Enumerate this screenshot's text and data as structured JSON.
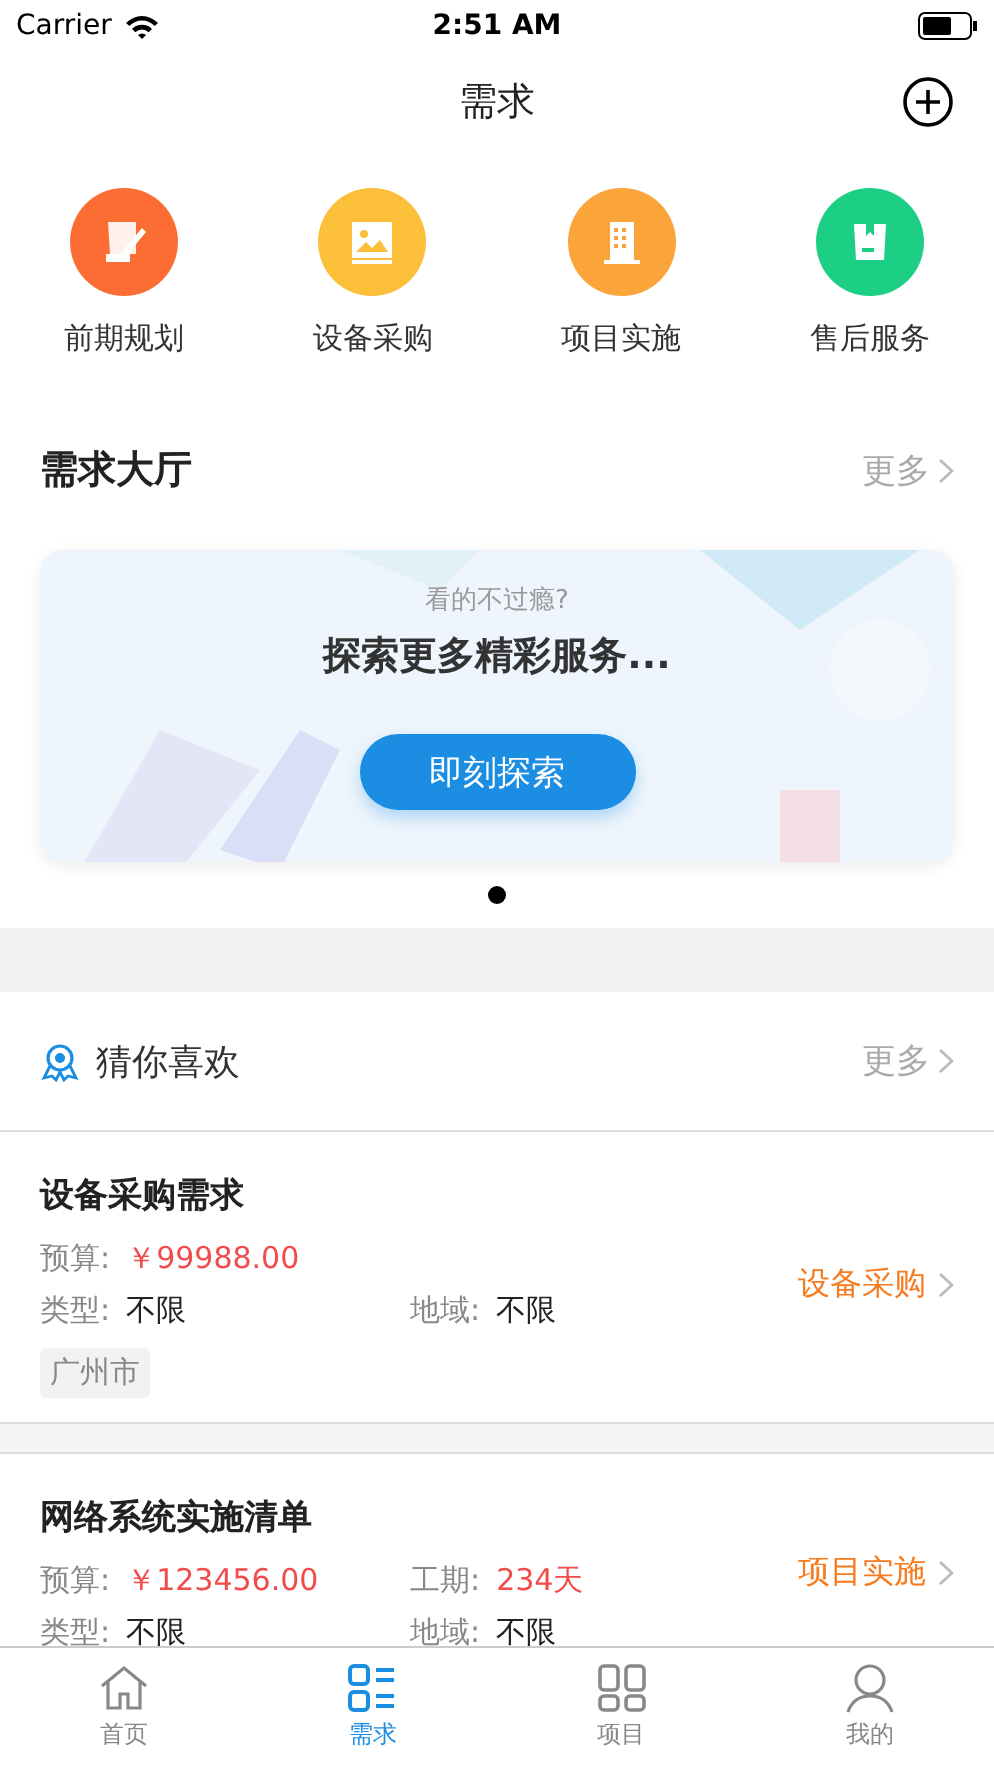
{
  "status_bar": {
    "carrier": "Carrier",
    "time": "2:51 AM"
  },
  "nav": {
    "title": "需求"
  },
  "categories": [
    {
      "label": "前期规划",
      "kind": "plan",
      "color": "#fb6d32"
    },
    {
      "label": "设备采购",
      "color": "#fbbf3a"
    },
    {
      "label": "项目实施",
      "kind": "building",
      "color": "#fba43a"
    },
    {
      "label": "售后服务",
      "kind": "bag",
      "color": "#1ccf85"
    }
  ],
  "hall": {
    "title": "需求大厅",
    "more": "更多",
    "banner": {
      "subtitle": "看的不过瘾?",
      "headline": "探索更多精彩服务...",
      "button": "即刻探索"
    },
    "dots": [
      {
        "selected": true
      }
    ]
  },
  "guess": {
    "title": "猜你喜欢",
    "more": "更多"
  },
  "cards": [
    {
      "title": "设备采购需求",
      "rows": [
        [
          {
            "label": "预算:",
            "value": "￥99988.00",
            "highlight": true
          }
        ],
        [
          {
            "label": "类型:",
            "value": "不限",
            "highlight": false
          },
          {
            "label": "地域:",
            "value": "不限",
            "highlight": false
          }
        ]
      ],
      "tag": "广州市",
      "link": "设备采购"
    },
    {
      "title": "网络系统实施清单",
      "rows": [
        [
          {
            "label": "预算:",
            "value": "￥123456.00",
            "highlight": true
          },
          {
            "label": "工期:",
            "value": "234天",
            "highlight": true
          }
        ],
        [
          {
            "label": "类型:",
            "value": "不限",
            "highlight": false
          },
          {
            "label": "地域:",
            "value": "不限",
            "highlight": false
          }
        ]
      ],
      "link": "项目实施"
    }
  ],
  "tabs": [
    {
      "label": "首页",
      "kind": "home",
      "selected": false
    },
    {
      "label": "需求",
      "kind": "list",
      "selected": true
    },
    {
      "label": "项目",
      "kind": "grid",
      "selected": false
    },
    {
      "label": "我的",
      "kind": "user",
      "selected": false
    }
  ]
}
